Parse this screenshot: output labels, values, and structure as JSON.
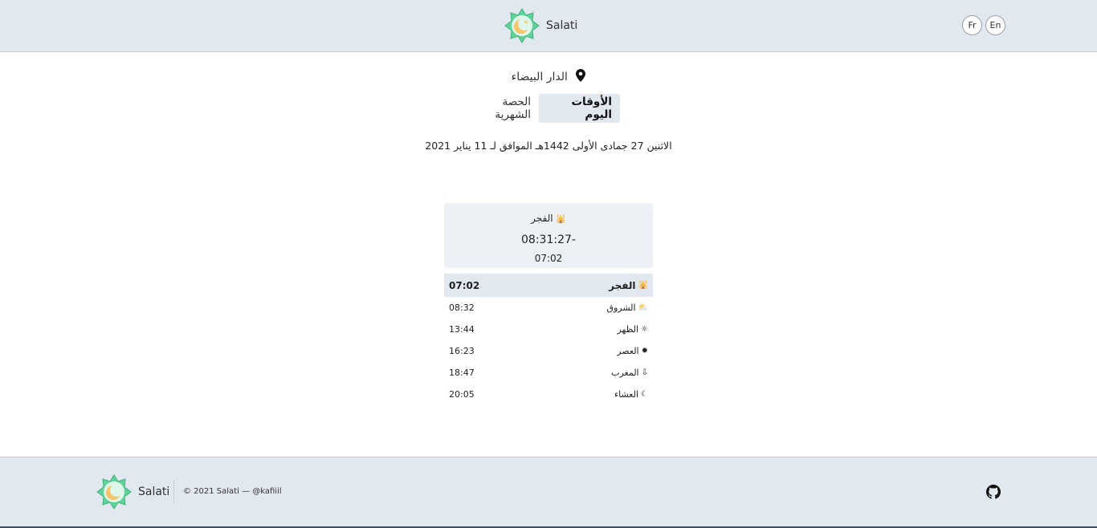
{
  "header": {
    "brand": "Salati",
    "lang_fr": "Fr",
    "lang_en": "En"
  },
  "location": {
    "city": "الدار البيضاء",
    "icon": "map-pin-icon"
  },
  "tabs": [
    {
      "label": "الأوقات اليوم",
      "active": true
    },
    {
      "label": "الحصة الشهرية",
      "active": false
    }
  ],
  "date_line": "الاثنين 27 جمادى الأولى 1442هـ الموافق لـ 11 يناير 2021",
  "next_prayer": {
    "icon": "🕌",
    "name": "الفجر",
    "countdown": "-08:31:27",
    "time": "07:02"
  },
  "prayers": [
    {
      "icon": "🕌",
      "name": "الفجر",
      "time": "07:02",
      "active": true
    },
    {
      "icon": "⛅",
      "name": "الشروق",
      "time": "08:32",
      "active": false
    },
    {
      "icon": "☼",
      "name": "الظهر",
      "time": "13:44",
      "active": false
    },
    {
      "icon": "✹",
      "name": "العصر",
      "time": "16:23",
      "active": false
    },
    {
      "icon": "⇩",
      "name": "المغرب",
      "time": "18:47",
      "active": false
    },
    {
      "icon": "☾",
      "name": "العشاء",
      "time": "20:05",
      "active": false
    }
  ],
  "footer": {
    "brand": "Salati",
    "copyright": "© 2021 Salati — @kafiiil",
    "github_icon": "github-icon"
  },
  "colors": {
    "header_bg": "#e2e8f0",
    "logo_star": "#3ecf8e",
    "logo_moon": "#f6c56b"
  }
}
